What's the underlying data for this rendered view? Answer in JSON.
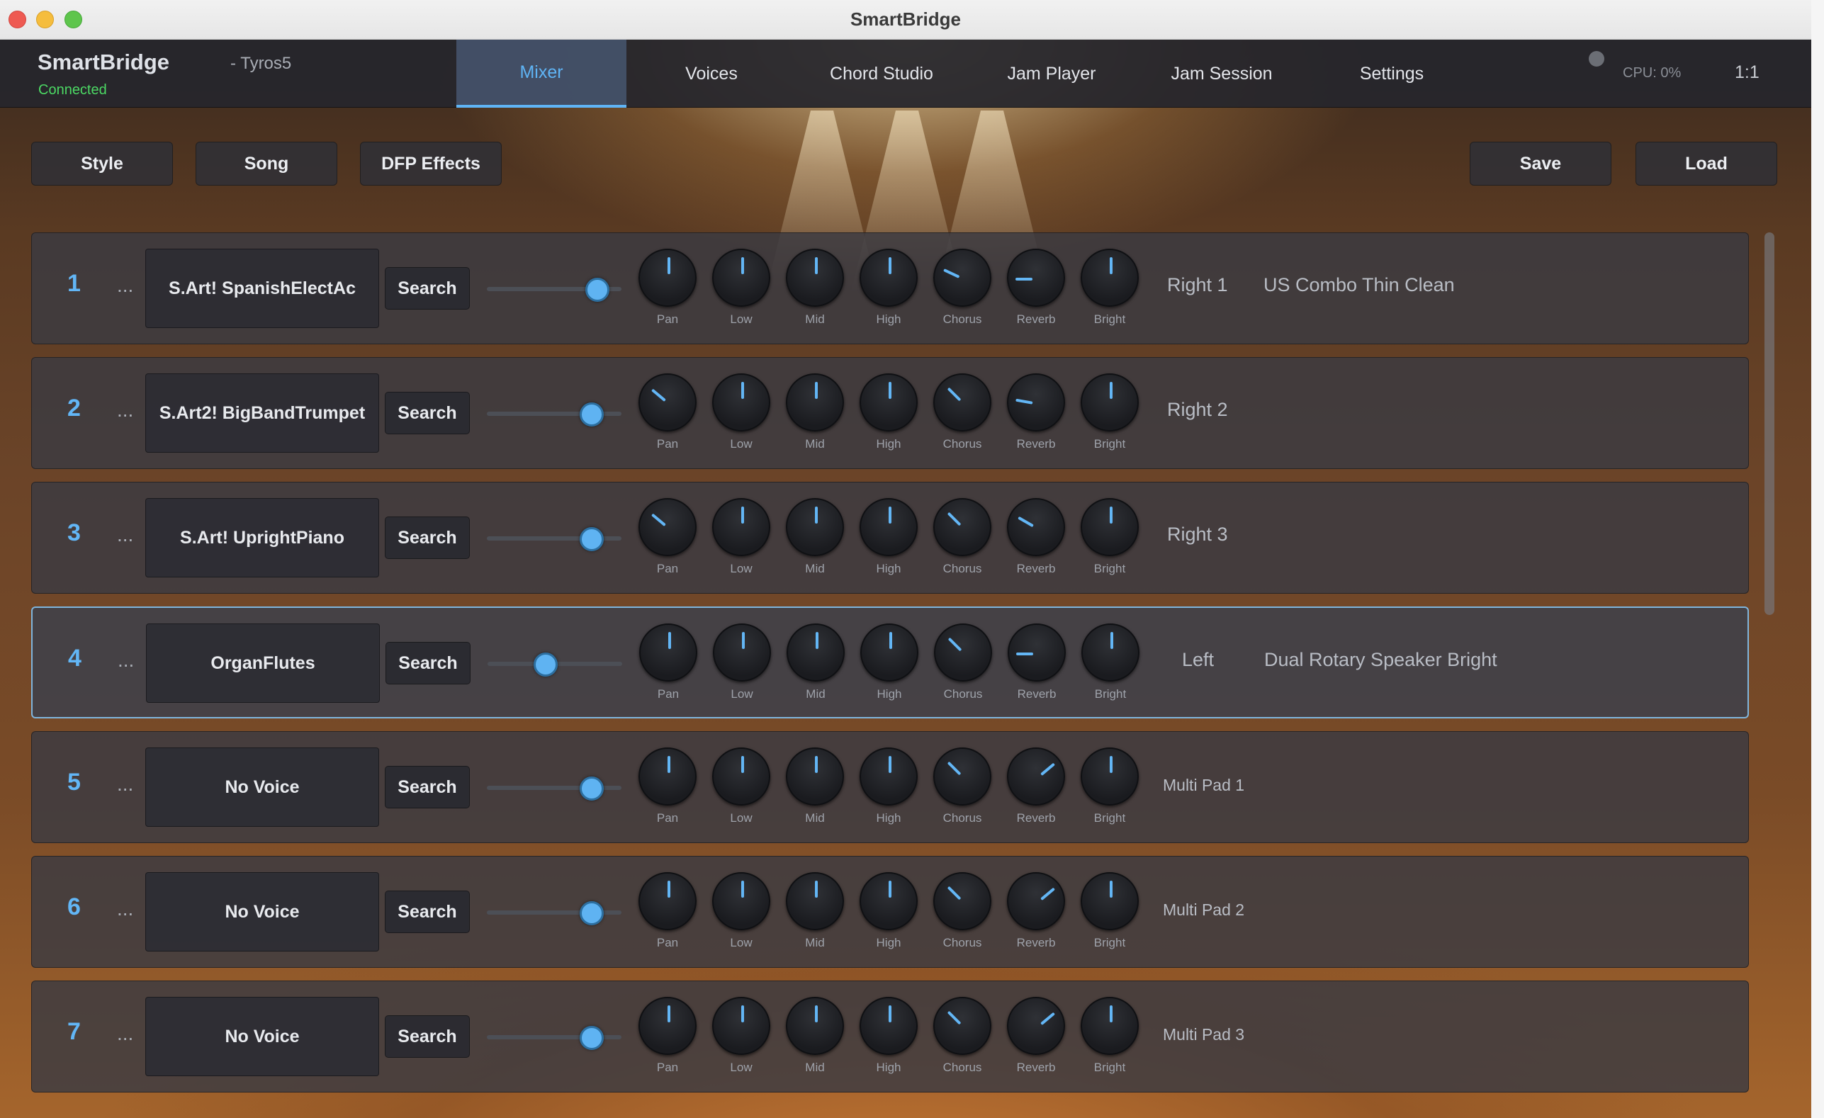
{
  "window": {
    "title": "SmartBridge"
  },
  "header": {
    "app_name": "SmartBridge",
    "connection_status": "Connected",
    "device": "- Tyros5",
    "cpu": "CPU: 0%",
    "ratio": "1:1"
  },
  "tabs": [
    {
      "label": "Mixer",
      "active": true
    },
    {
      "label": "Voices",
      "active": false
    },
    {
      "label": "Chord Studio",
      "active": false
    },
    {
      "label": "Jam Player",
      "active": false
    },
    {
      "label": "Jam Session",
      "active": false
    },
    {
      "label": "Settings",
      "active": false
    }
  ],
  "toolbar": {
    "style": "Style",
    "song": "Song",
    "dfp_effects": "DFP Effects",
    "save": "Save",
    "load": "Load"
  },
  "knob_labels": [
    "Pan",
    "Low",
    "Mid",
    "High",
    "Chorus",
    "Reverb",
    "Bright"
  ],
  "search_label": "Search",
  "more_label": "...",
  "channels": [
    {
      "num": "1",
      "voice": "S.Art! SpanishElectAc",
      "volume": 0.82,
      "knobs_deg": [
        0,
        0,
        0,
        0,
        -65,
        -90,
        0
      ],
      "part": "Right 1",
      "effect": "US Combo Thin Clean",
      "selected": false
    },
    {
      "num": "2",
      "voice": "S.Art2! BigBandTrumpet",
      "volume": 0.78,
      "knobs_deg": [
        -50,
        0,
        0,
        0,
        -45,
        -80,
        0
      ],
      "part": "Right 2",
      "effect": "",
      "selected": false
    },
    {
      "num": "3",
      "voice": "S.Art! UprightPiano",
      "volume": 0.78,
      "knobs_deg": [
        -50,
        0,
        0,
        0,
        -45,
        -60,
        0
      ],
      "part": "Right 3",
      "effect": "",
      "selected": false
    },
    {
      "num": "4",
      "voice": "OrganFlutes",
      "volume": 0.43,
      "knobs_deg": [
        0,
        0,
        0,
        0,
        -45,
        -90,
        0
      ],
      "part": "Left",
      "effect": "Dual Rotary Speaker Bright",
      "selected": true
    },
    {
      "num": "5",
      "voice": "No Voice",
      "volume": 0.78,
      "knobs_deg": [
        0,
        0,
        0,
        0,
        -45,
        50,
        0
      ],
      "part": "Multi Pad 1",
      "effect": "",
      "selected": false
    },
    {
      "num": "6",
      "voice": "No Voice",
      "volume": 0.78,
      "knobs_deg": [
        0,
        0,
        0,
        0,
        -45,
        50,
        0
      ],
      "part": "Multi Pad 2",
      "effect": "",
      "selected": false
    },
    {
      "num": "7",
      "voice": "No Voice",
      "volume": 0.78,
      "knobs_deg": [
        0,
        0,
        0,
        0,
        -45,
        50,
        0
      ],
      "part": "Multi Pad 3",
      "effect": "",
      "selected": false
    }
  ],
  "colors": {
    "accent": "#5fb4f5",
    "connected": "#4cd964"
  }
}
